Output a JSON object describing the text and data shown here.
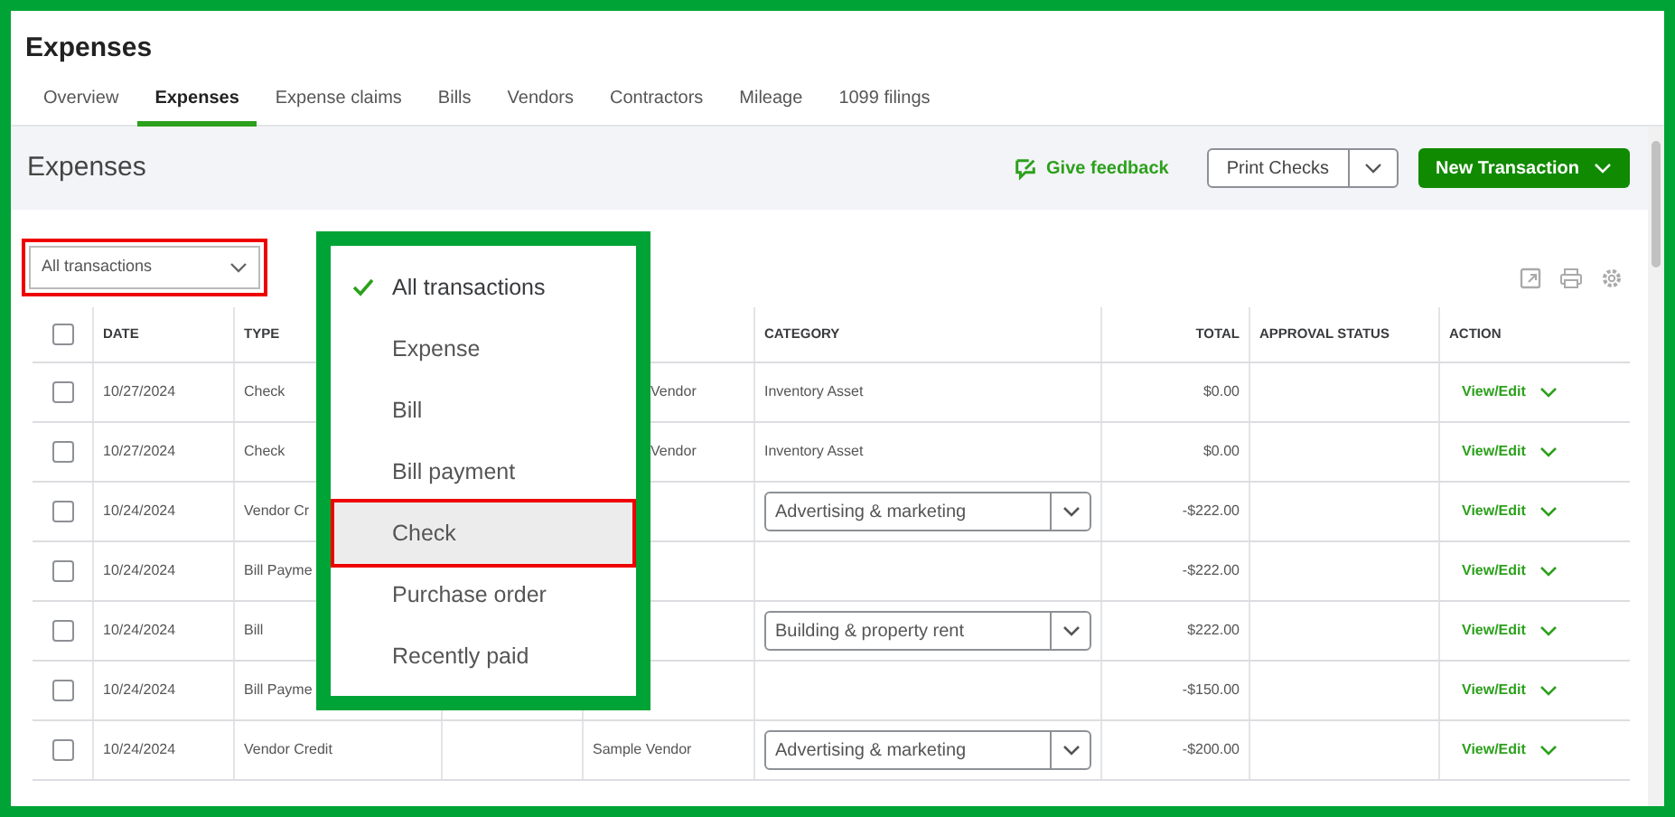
{
  "app_title": "Expenses",
  "tabs": [
    {
      "label": "Overview",
      "selected": false
    },
    {
      "label": "Expenses",
      "selected": true
    },
    {
      "label": "Expense claims",
      "selected": false
    },
    {
      "label": "Bills",
      "selected": false
    },
    {
      "label": "Vendors",
      "selected": false
    },
    {
      "label": "Contractors",
      "selected": false
    },
    {
      "label": "Mileage",
      "selected": false
    },
    {
      "label": "1099 filings",
      "selected": false
    }
  ],
  "header": {
    "title": "Expenses",
    "feedback": "Give feedback",
    "print_button": "Print Checks",
    "new_button": "New Transaction"
  },
  "filter": {
    "value": "All transactions",
    "highlighted": true
  },
  "filter_menu": [
    {
      "label": "All transactions",
      "selected": true,
      "highlighted": false
    },
    {
      "label": "Expense",
      "selected": false,
      "highlighted": false
    },
    {
      "label": "Bill",
      "selected": false,
      "highlighted": false
    },
    {
      "label": "Bill payment",
      "selected": false,
      "highlighted": false
    },
    {
      "label": "Check",
      "selected": false,
      "highlighted": true
    },
    {
      "label": "Purchase order",
      "selected": false,
      "highlighted": false
    },
    {
      "label": "Recently paid",
      "selected": false,
      "highlighted": false
    }
  ],
  "table": {
    "columns": [
      "DATE",
      "TYPE",
      "",
      "",
      "CATEGORY",
      "TOTAL",
      "APPROVAL STATUS",
      "ACTION"
    ],
    "select_all_checked": false,
    "rows": [
      {
        "checked": false,
        "date": "10/27/2024",
        "type": "Check",
        "payee": "Vendor",
        "payee_clipped": true,
        "category": {
          "kind": "text",
          "value": "Inventory Asset"
        },
        "total": "$0.00",
        "action": "View/Edit"
      },
      {
        "checked": false,
        "date": "10/27/2024",
        "type": "Check",
        "payee": "Vendor",
        "payee_clipped": true,
        "category": {
          "kind": "text",
          "value": "Inventory Asset"
        },
        "total": "$0.00",
        "action": "View/Edit"
      },
      {
        "checked": false,
        "date": "10/24/2024",
        "type": "Vendor Cr",
        "payee": "",
        "payee_clipped": false,
        "category": {
          "kind": "select",
          "value": "Advertising & marketing"
        },
        "total": "-$222.00",
        "action": "View/Edit"
      },
      {
        "checked": false,
        "date": "10/24/2024",
        "type": "Bill Payme",
        "payee": "",
        "payee_clipped": false,
        "category": {
          "kind": "none"
        },
        "total": "-$222.00",
        "action": "View/Edit"
      },
      {
        "checked": false,
        "date": "10/24/2024",
        "type": "Bill",
        "payee": "",
        "payee_clipped": false,
        "category": {
          "kind": "select",
          "value": "Building & property rent"
        },
        "total": "$222.00",
        "action": "View/Edit"
      },
      {
        "checked": false,
        "date": "10/24/2024",
        "type": "Bill Payme",
        "payee": "",
        "payee_clipped": false,
        "category": {
          "kind": "none"
        },
        "total": "-$150.00",
        "action": "View/Edit"
      },
      {
        "checked": false,
        "date": "10/24/2024",
        "type": "Vendor Credit",
        "payee": "Sample Vendor",
        "payee_clipped": false,
        "category": {
          "kind": "select",
          "value": "Advertising & marketing"
        },
        "total": "-$200.00",
        "action": "View/Edit"
      }
    ]
  }
}
